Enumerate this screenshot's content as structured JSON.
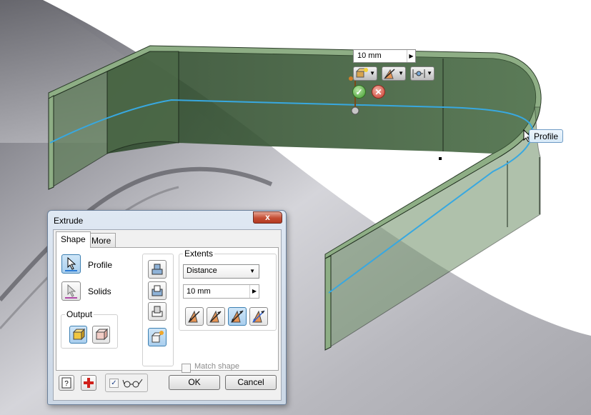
{
  "viewport": {
    "distance_value": "10 mm",
    "profile_tooltip": "Profile"
  },
  "dialog": {
    "title": "Extrude",
    "close_label": "x",
    "tabs": [
      {
        "label": "Shape",
        "active": true
      },
      {
        "label": "More",
        "active": false
      }
    ],
    "profile_label": "Profile",
    "solids_label": "Solids",
    "output_title": "Output",
    "extents_title": "Extents",
    "extents_type": "Distance",
    "distance_value": "10 mm",
    "match_shape_label": "Match shape",
    "match_shape_checked": false,
    "preview_checked": true,
    "ok_label": "OK",
    "cancel_label": "Cancel"
  },
  "colors": {
    "part_green": "#3f5e3b",
    "part_edge": "#1d2a1c",
    "profile_line": "#38a8e0",
    "accent_blue": "#3c7fb1"
  }
}
